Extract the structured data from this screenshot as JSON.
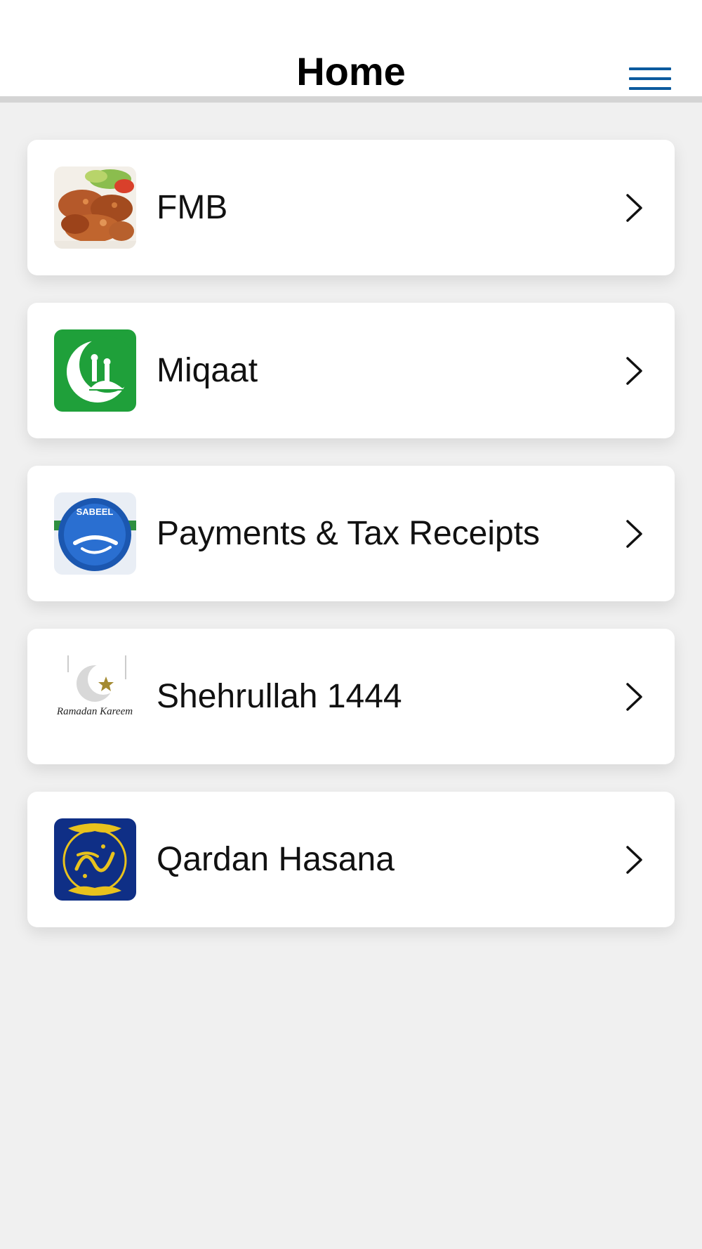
{
  "header": {
    "title": "Home",
    "menu_icon": "hamburger-menu-icon",
    "accent": "#0b5a9e"
  },
  "items": [
    {
      "label": "FMB",
      "icon": "chicken-food-icon"
    },
    {
      "label": "Miqaat",
      "icon": "crescent-mosque-icon"
    },
    {
      "label": "Payments & Tax Receipts",
      "icon": "sabeel-logo-icon",
      "logo_text": "SABEEL"
    },
    {
      "label": "Shehrullah 1444",
      "icon": "ramadan-kareem-icon",
      "logo_text": "Ramadan Kareem"
    },
    {
      "label": "Qardan Hasana",
      "icon": "qardan-hasana-calligraphy-icon"
    }
  ]
}
